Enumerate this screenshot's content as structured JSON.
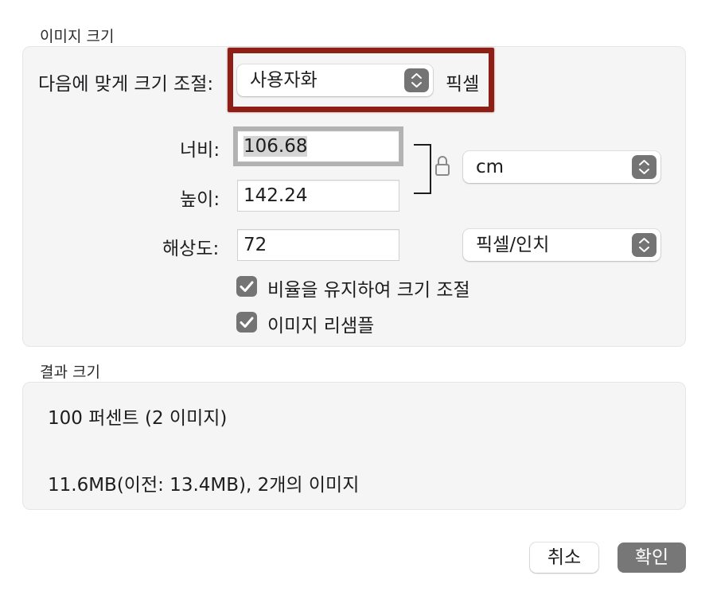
{
  "image_size": {
    "title": "이미지 크기",
    "fit_label": "다음에 맞게 크기 조절:",
    "fit_value": "사용자화",
    "fit_unit": "픽셀",
    "width_label": "너비:",
    "width_value": "106.68",
    "height_label": "높이:",
    "height_value": "142.24",
    "size_unit": "cm",
    "resolution_label": "해상도:",
    "resolution_value": "72",
    "resolution_unit": "픽셀/인치",
    "keep_ratio_label": "비율을 유지하여 크기 조절",
    "keep_ratio_checked": true,
    "resample_label": "이미지 리샘플",
    "resample_checked": true
  },
  "result": {
    "title": "결과 크기",
    "percent_text": "100 퍼센트 (2 이미지)",
    "size_text": "11.6MB(이전: 13.4MB), 2개의 이미지"
  },
  "buttons": {
    "cancel": "취소",
    "ok": "확인"
  },
  "colors": {
    "annotation": "#8d1f17",
    "stepper": "#747474",
    "ok_button": "#777777"
  }
}
